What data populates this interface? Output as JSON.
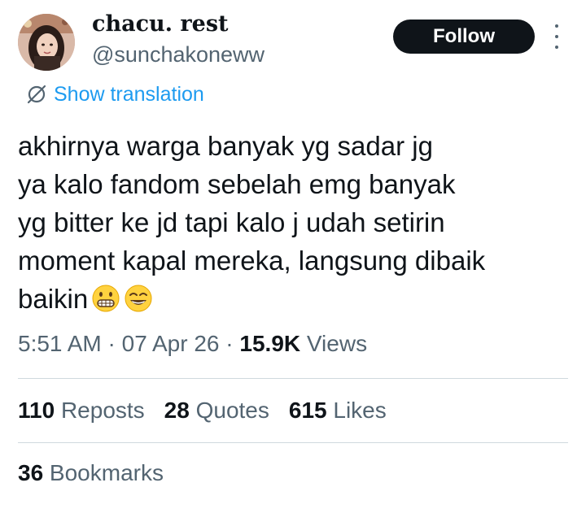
{
  "author": {
    "display_name": "chacu. rest",
    "handle": "@sunchakoneww"
  },
  "actions": {
    "follow_label": "Follow"
  },
  "translation": {
    "label": "Show translation",
    "icon": "translate-icon"
  },
  "tweet": {
    "lines": [
      "akhirnya warga banyak yg sadar jg",
      "ya kalo fandom sebelah emg banyak",
      "yg bitter ke jd tapi kalo j udah setirin",
      "moment kapal mereka, langsung dibaik",
      "baikin"
    ],
    "emojis": [
      "grimacing-face-emoji",
      "grinning-squinting-face-emoji"
    ]
  },
  "meta": {
    "time": "5:51 AM",
    "sep1": " · ",
    "date": "07 Apr 26",
    "sep2": " · ",
    "views_count": "15.9K",
    "views_label": " Views"
  },
  "stats": {
    "reposts_count": "110",
    "reposts_label": " Reposts",
    "quotes_count": "28",
    "quotes_label": " Quotes",
    "likes_count": "615",
    "likes_label": " Likes",
    "bookmarks_count": "36",
    "bookmarks_label": " Bookmarks"
  },
  "colors": {
    "text_primary": "#0f1419",
    "text_secondary": "#536471",
    "link_blue": "#1d9bf0",
    "divider": "#cfd9de",
    "button_bg": "#0f1419"
  }
}
